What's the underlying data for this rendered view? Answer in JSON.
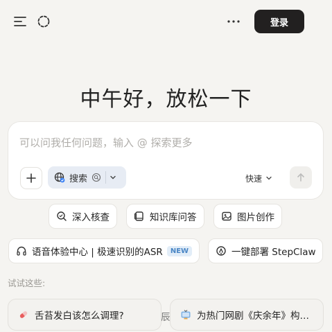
{
  "header": {
    "menu_icon": "menu-icon",
    "loader_icon": "dashed-circle-icon",
    "more_icon": "more-horizontal-icon",
    "login_label": "登录"
  },
  "main": {
    "greeting": "中午好，放松一下"
  },
  "composer": {
    "placeholder": "可以问我任何问题，输入 @ 探索更多",
    "value": "",
    "add_icon": "plus-icon",
    "search_label": "搜索",
    "speed_label": "快速",
    "send_icon": "arrow-up-icon"
  },
  "chips": [
    {
      "label": "深入核查",
      "icon": "search-check-icon"
    },
    {
      "label": "知识库问答",
      "icon": "knowledge-base-icon"
    },
    {
      "label": "图片创作",
      "icon": "image-icon"
    },
    {
      "label": "语音体验中心 | 极速识别的ASR",
      "icon": "headphones-icon",
      "badge": "NEW"
    },
    {
      "label": "一键部署 StepClaw",
      "icon": "deploy-icon"
    }
  ],
  "suggestions": {
    "label": "试试这些:",
    "items": [
      {
        "text": "舌苔发白该怎么调理?",
        "icon": "pill-icon"
      },
      {
        "text": "为热门网剧《庆余年》构…",
        "icon": "tv-icon"
      }
    ],
    "peek_text": "辰"
  },
  "colors": {
    "background": "#f5f4f1",
    "login_bg": "#222020",
    "search_pill_bg": "#e7ecf4",
    "badge_text": "#4a86c5",
    "badge_bg": "#e2edf8"
  }
}
